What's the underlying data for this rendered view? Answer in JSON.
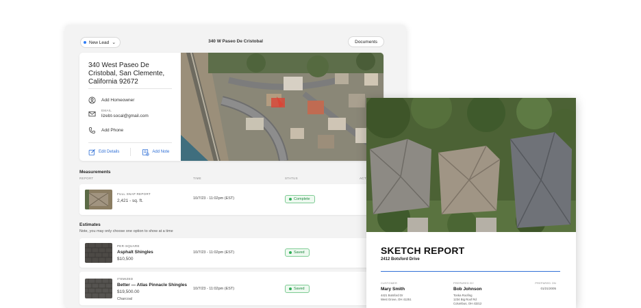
{
  "topbar": {
    "lead_status": "New Lead",
    "address_title": "340 W Paseo De Cristobal",
    "documents_label": "Documents"
  },
  "property": {
    "address": "340 West Paseo De Cristobal, San Clemente, California 92672",
    "homeowner_label": "Add Homeowner",
    "email_label": "EMAIL",
    "email_value": "lizebt-socal@gmail.com",
    "phone_label": "Add Phone",
    "edit_details_label": "Edit Details",
    "add_note_label": "Add Note"
  },
  "measurements": {
    "section_title": "Measurements",
    "columns": [
      "REPORT",
      "TIME",
      "STATUS",
      "ACT"
    ],
    "rows": [
      {
        "report_type": "FULL SNAP REPORT",
        "value": "2,421 - sq. ft.",
        "time": "10/7/23 - 11:02pm (EST)",
        "status": "Complete"
      }
    ]
  },
  "estimates": {
    "section_title": "Estimates",
    "note": "Note, you may only choose one option to show at a time",
    "rows": [
      {
        "pricing_type": "PER-SQUARE",
        "name": "Asphalt Shingles",
        "price": "$10,500",
        "color": "",
        "time": "10/7/23 - 11:02pm (EST)",
        "status": "Saved"
      },
      {
        "pricing_type": "ITEMIZED",
        "name": "Better — Atlas Pinnacle Shingles",
        "price": "$19,500.00",
        "color": "Charcoal",
        "time": "10/7/23 - 11:02pm (EST)",
        "status": "Saved"
      }
    ]
  },
  "sketch_report": {
    "title": "SKETCH REPORT",
    "address": "2412 Botsford Drive",
    "customer_label": "CUSTOMER",
    "customer_name": "Mary Smith",
    "customer_address_1": "4421 Botsford Dr",
    "customer_address_2": "West Grove, OH 41251",
    "prepared_by_label": "PREPARED BY",
    "preparer_name": "Bob Johnson",
    "preparer_company": "Tonka Roofing",
    "preparer_address_1": "1234 Big Roof Rd",
    "preparer_address_2": "Columbus, OH 43212",
    "prepared_on_label": "PREPARED ON",
    "prepared_on_date": "01/21/2005"
  },
  "colors": {
    "accent_blue": "#2f6fd6",
    "status_green": "#2fae57",
    "panel_bg": "#f3f3f3"
  },
  "icons": [
    "chevron-down-icon",
    "user-circle-icon",
    "mail-icon",
    "phone-icon",
    "edit-icon",
    "note-icon"
  ]
}
